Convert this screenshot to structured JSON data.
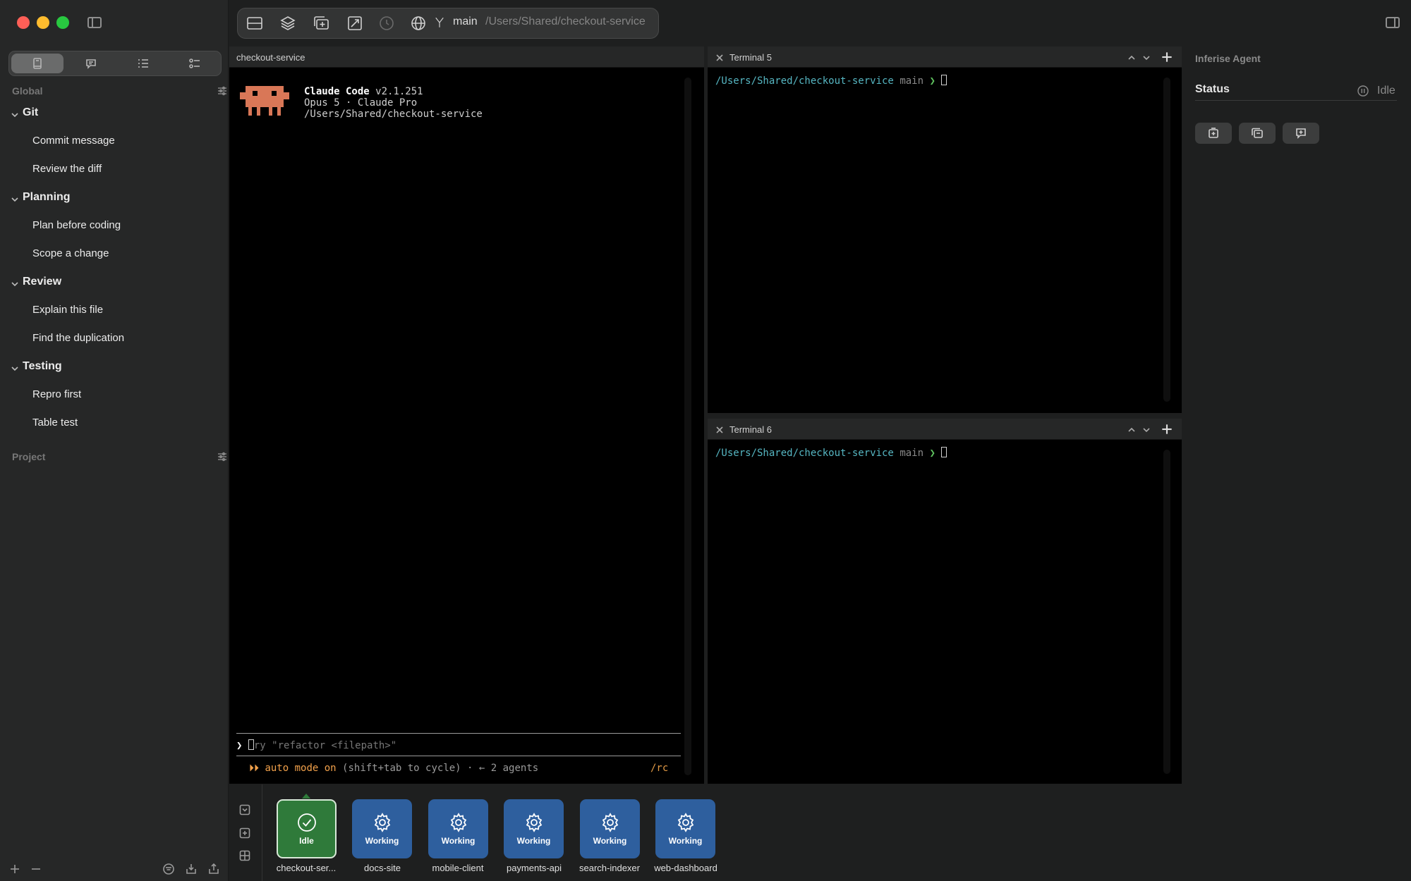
{
  "sidebar": {
    "global_label": "Global",
    "project_label": "Project",
    "groups": [
      {
        "title": "Git",
        "items": [
          "Commit message",
          "Review the diff"
        ]
      },
      {
        "title": "Planning",
        "items": [
          "Plan before coding",
          "Scope a change"
        ]
      },
      {
        "title": "Review",
        "items": [
          "Explain this file",
          "Find the duplication"
        ]
      },
      {
        "title": "Testing",
        "items": [
          "Repro first",
          "Table test"
        ]
      }
    ]
  },
  "toolbar": {
    "branch": "main",
    "path": "/Users/Shared/checkout-service"
  },
  "left_pane": {
    "tab_title": "checkout-service",
    "claude": {
      "title": "Claude Code",
      "version": "v2.1.251",
      "model_line": "Opus 5 · Claude Pro",
      "path_line": "/Users/Shared/checkout-service"
    },
    "input_prompt": "❯",
    "input_placeholder": "ry \"refactor <filepath>\"",
    "mode_marker": "⏵⏵",
    "mode_text": "auto mode on",
    "mode_hint": "(shift+tab to cycle) · ← 2 agents",
    "rc_command": "/rc"
  },
  "terminals": [
    {
      "title": "Terminal 5",
      "path": "/Users/Shared/checkout-service",
      "branch": "main",
      "arrow": "❯"
    },
    {
      "title": "Terminal 6",
      "path": "/Users/Shared/checkout-service",
      "branch": "main",
      "arrow": "❯"
    }
  ],
  "right_panel": {
    "title": "Inferise Agent",
    "status_label": "Status",
    "status_value": "Idle"
  },
  "agents": [
    {
      "name": "checkout-ser...",
      "state": "Idle",
      "icon": "check-circle-icon",
      "color": "#2f7a3a"
    },
    {
      "name": "docs-site",
      "state": "Working",
      "icon": "gear-icon",
      "color": "#2e5f9e"
    },
    {
      "name": "mobile-client",
      "state": "Working",
      "icon": "gear-icon",
      "color": "#2e5f9e"
    },
    {
      "name": "payments-api",
      "state": "Working",
      "icon": "gear-icon",
      "color": "#2e5f9e"
    },
    {
      "name": "search-indexer",
      "state": "Working",
      "icon": "gear-icon",
      "color": "#2e5f9e"
    },
    {
      "name": "web-dashboard",
      "state": "Working",
      "icon": "gear-icon",
      "color": "#2e5f9e"
    }
  ]
}
